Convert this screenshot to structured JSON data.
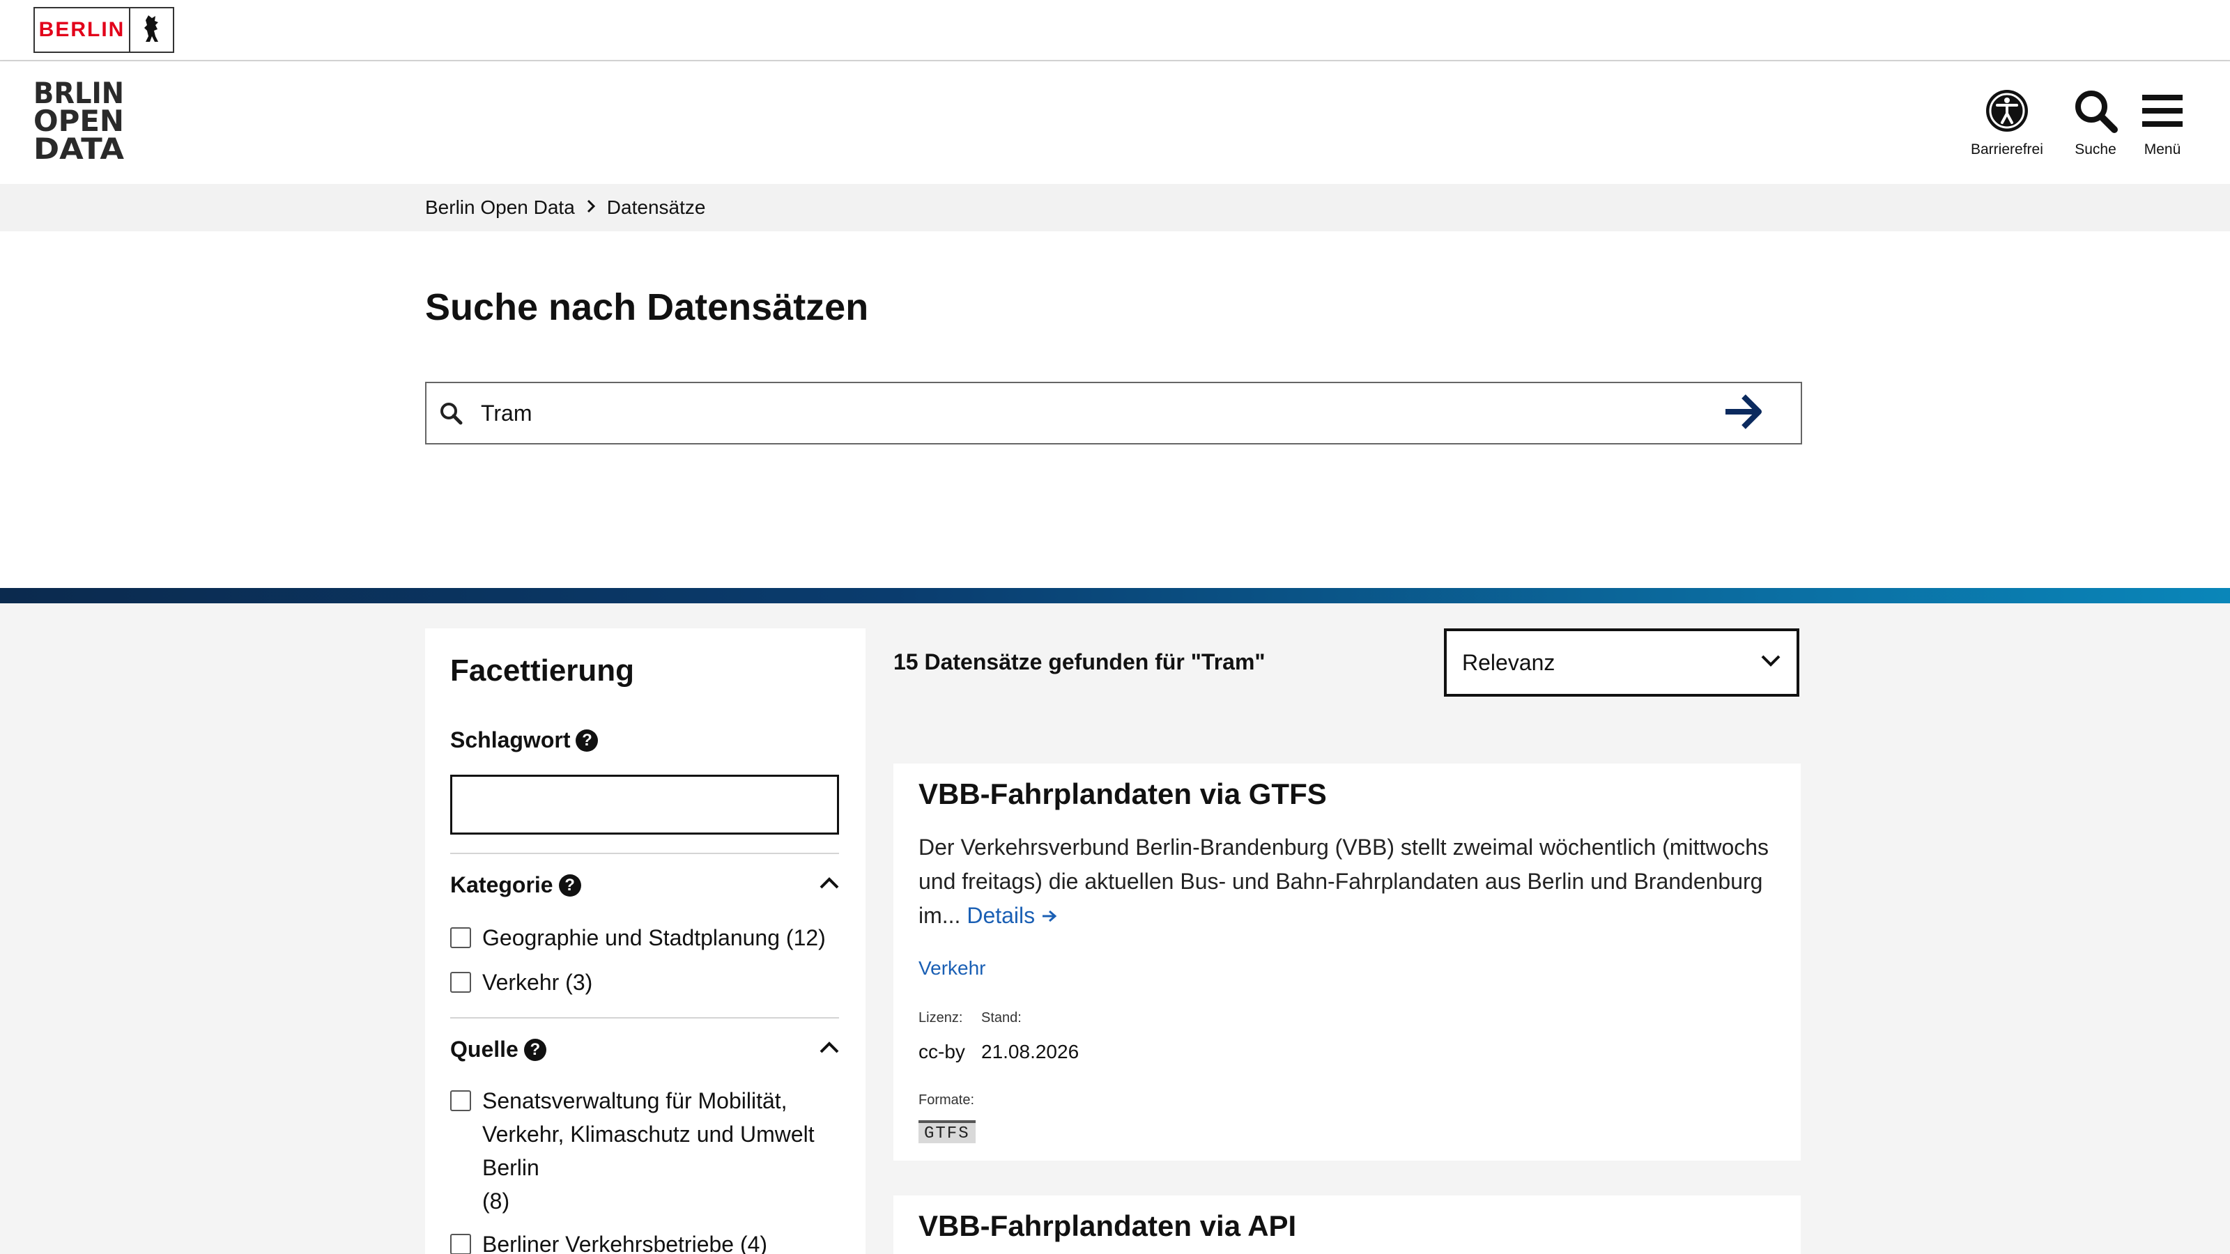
{
  "topbar": {
    "berlin_logo_text": "BERLIN"
  },
  "header": {
    "accessibility_label": "Barrierefrei",
    "search_label": "Suche",
    "menu_label": "Menü"
  },
  "breadcrumb": {
    "items": [
      "Berlin Open Data",
      "Datensätze"
    ]
  },
  "search": {
    "title": "Suche nach Datensätzen",
    "value": "Tram"
  },
  "facets": {
    "heading": "Facettierung",
    "tag": {
      "label": "Schlagwort",
      "value": ""
    },
    "category": {
      "label": "Kategorie",
      "items": [
        {
          "label": "Geographie und Stadtplanung (12)"
        },
        {
          "label": "Verkehr (3)"
        }
      ]
    },
    "source": {
      "label": "Quelle",
      "items": [
        {
          "label": "Senatsverwaltung für Mobilität, Verkehr, Klimaschutz und Umwelt Berlin",
          "count": "(8)"
        },
        {
          "label": "Berliner Verkehrsbetriebe (4)"
        }
      ]
    }
  },
  "results": {
    "count_text": "15 Datensätze gefunden für \"Tram\"",
    "sort": {
      "selected": "Relevanz"
    },
    "items": [
      {
        "title": "VBB-Fahrplandaten via GTFS",
        "description": "Der Verkehrsverbund Berlin-Brandenburg (VBB) stellt zweimal wöchentlich (mittwochs und freitags) die aktuellen Bus- und Bahn-Fahrplandaten aus Berlin und Brandenburg im...",
        "details_label": "Details",
        "category": "Verkehr",
        "license_label": "Lizenz:",
        "license": "cc-by",
        "date_label": "Stand:",
        "date": "21.08.2026",
        "formats_label": "Formate:",
        "formats": [
          "GTFS"
        ]
      },
      {
        "title": "VBB-Fahrplandaten via API"
      }
    ]
  },
  "colors": {
    "accent_blue": "#1a5fb4",
    "berlin_red": "#e2001a",
    "arrow_navy": "#0b2a5e"
  }
}
